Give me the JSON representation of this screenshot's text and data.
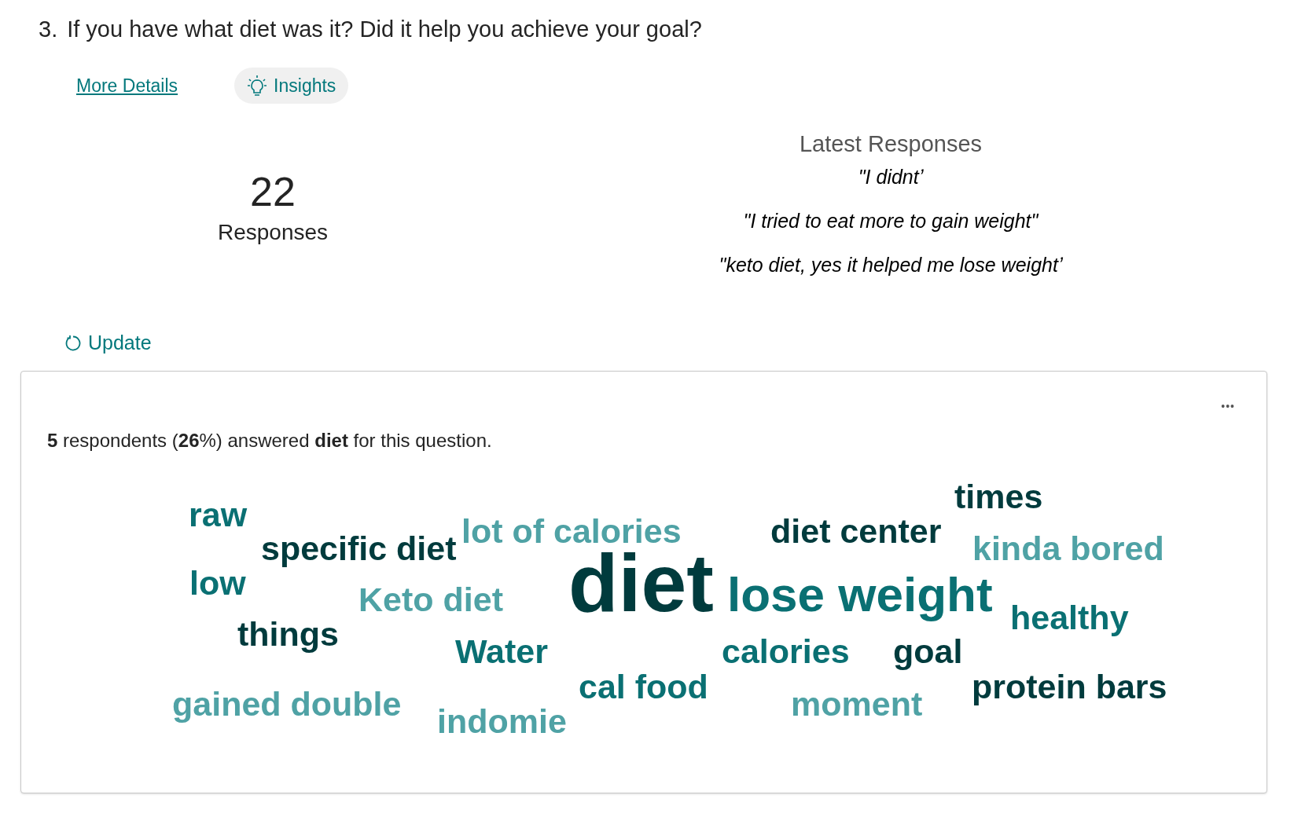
{
  "question": {
    "number": "3.",
    "text": "If you have what diet was it? Did it help you achieve your goal?"
  },
  "links": {
    "more_details": "More Details",
    "insights": "Insights"
  },
  "summary": {
    "count": "22",
    "label": "Responses"
  },
  "latest": {
    "title": "Latest Responses",
    "responses": [
      "\"I didntʼ",
      "\"I tried to eat more to gain weight\"",
      "\"keto diet, yes it helped me lose weightʼ"
    ]
  },
  "update": "Update",
  "card": {
    "menu": "•••",
    "statement": "**5** respondents (**26**%) answered **diet** for this question.",
    "words": [
      {
        "text": "raw",
        "color": "#0a7073"
      },
      {
        "text": "specific diet",
        "color": "#003b3d"
      },
      {
        "text": "lot of calories",
        "color": "#4fa2a5"
      },
      {
        "text": "diet",
        "color": "#003b3d"
      },
      {
        "text": "diet center",
        "color": "#003b3d"
      },
      {
        "text": "times",
        "color": "#003b3d"
      },
      {
        "text": "kinda bored",
        "color": "#4fa2a5"
      },
      {
        "text": "low",
        "color": "#0a7073"
      },
      {
        "text": "Keto diet",
        "color": "#4fa2a5"
      },
      {
        "text": "lose weight",
        "color": "#0a7073"
      },
      {
        "text": "healthy",
        "color": "#0a7073"
      },
      {
        "text": "things",
        "color": "#003b3d"
      },
      {
        "text": "Water",
        "color": "#0a7073"
      },
      {
        "text": "calories",
        "color": "#0a7073"
      },
      {
        "text": "goal",
        "color": "#003b3d"
      },
      {
        "text": "cal food",
        "color": "#0a7073"
      },
      {
        "text": "protein bars",
        "color": "#003b3d"
      },
      {
        "text": "gained double",
        "color": "#4fa2a5"
      },
      {
        "text": "moment",
        "color": "#4fa2a5"
      },
      {
        "text": "indomie",
        "color": "#4fa2a5"
      }
    ]
  }
}
